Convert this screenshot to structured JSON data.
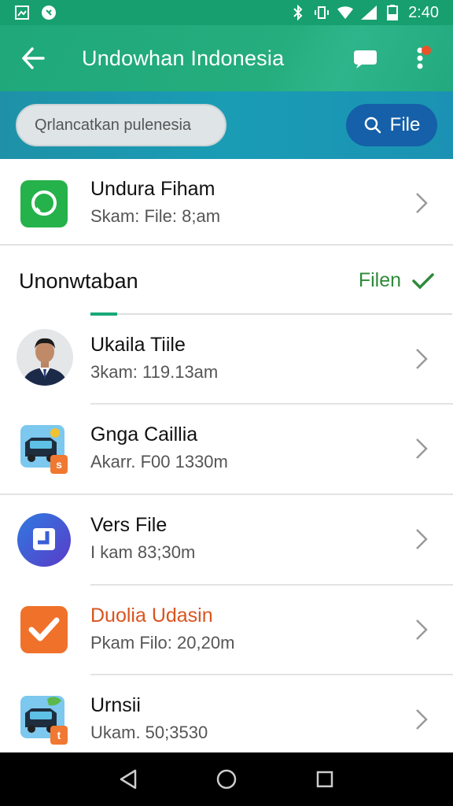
{
  "status_bar": {
    "time": "2:40"
  },
  "app_bar": {
    "title": "Undowhan Indonesia"
  },
  "search": {
    "placeholder": "Qrlancatkan pulenesia",
    "button_label": "File"
  },
  "pinned": {
    "title": "Undura Fiham",
    "subtitle": "Skam: File: 8;am",
    "icon": "whatsapp-icon"
  },
  "section": {
    "title": "Unonwtaban",
    "action_label": "Filen"
  },
  "items": [
    {
      "title": "Ukaila Tiile",
      "subtitle": "3kam: 119.13am",
      "icon": "person-avatar"
    },
    {
      "title": "Gnga Caillia",
      "subtitle": "Akarr. F00 1330m",
      "icon": "taxi-icon"
    },
    {
      "title": "Vers File",
      "subtitle": "I kam 83;30m",
      "icon": "app-j-icon"
    },
    {
      "title": "Duolia Udasin",
      "subtitle": "Pkam Filo: 20,20m",
      "icon": "checkmark-icon",
      "title_color": "#d9541e"
    },
    {
      "title": "Urnsii",
      "subtitle": "Ukam. 50;3530",
      "icon": "taxi-icon"
    }
  ],
  "colors": {
    "app_bar": "#1fa87a",
    "search_band": "#1a9cb5",
    "file_button": "#1560a8",
    "section_action": "#2e8a3a"
  }
}
